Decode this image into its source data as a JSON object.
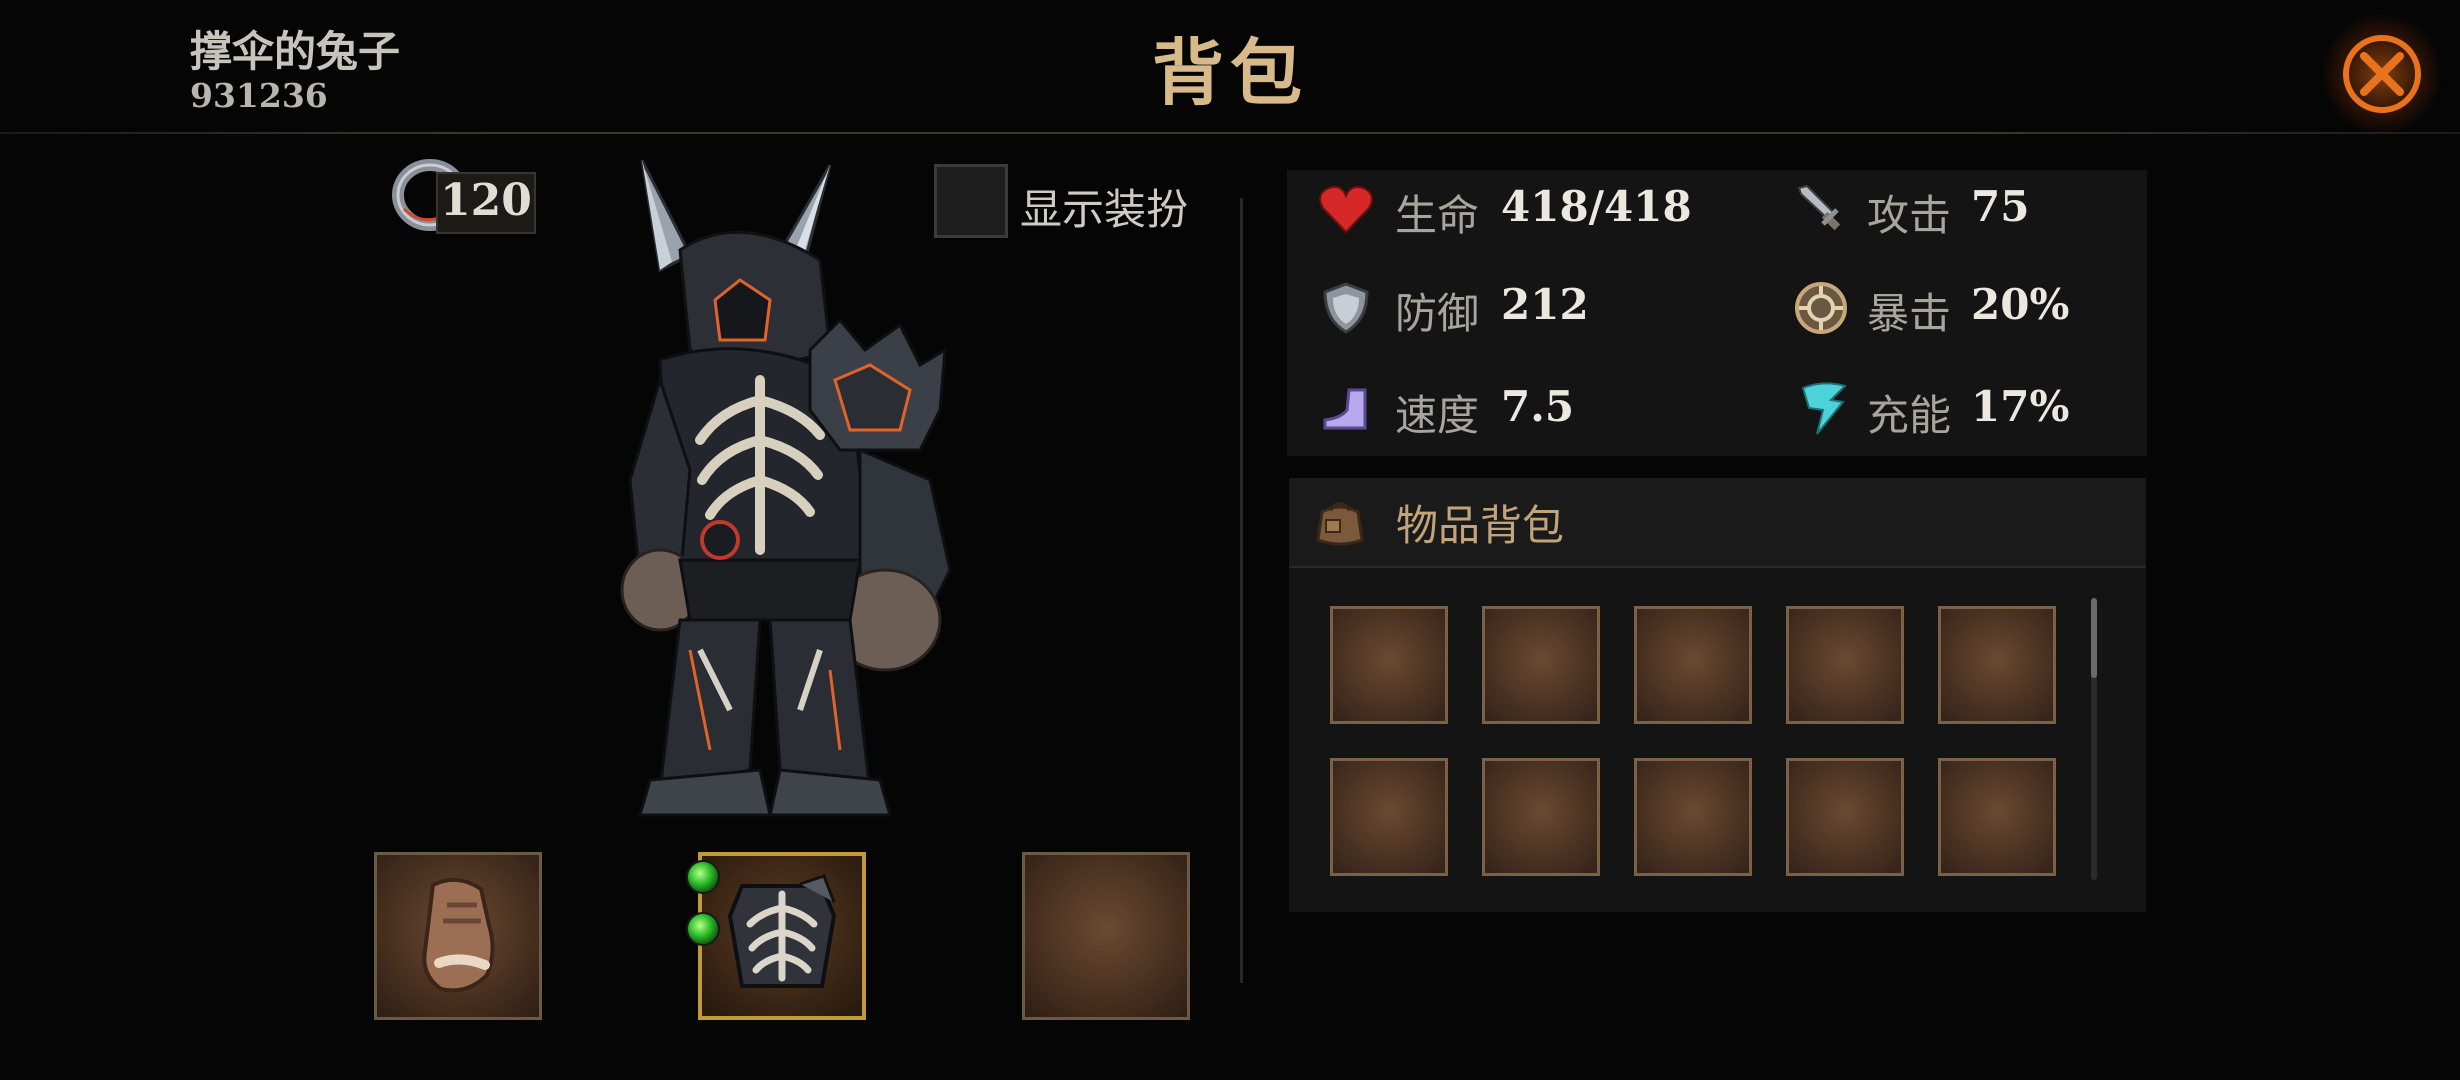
{
  "header": {
    "player_name": "撑伞的兔子",
    "player_id": "931236",
    "title": "背包"
  },
  "left_panel": {
    "ring_count": "120",
    "show_outfit_label": "显示装扮",
    "show_outfit_checked": false,
    "equipment_slots": [
      {
        "name": "gloves",
        "filled": true
      },
      {
        "name": "armor",
        "filled": true,
        "gems": 2
      },
      {
        "name": "empty",
        "filled": false
      }
    ]
  },
  "stats": {
    "hp_label": "生命",
    "hp_value": "418/418",
    "attack_label": "攻击",
    "attack_value": "75",
    "defense_label": "防御",
    "defense_value": "212",
    "crit_label": "暴击",
    "crit_value": "20%",
    "speed_label": "速度",
    "speed_value": "7.5",
    "charge_label": "充能",
    "charge_value": "17%"
  },
  "inventory": {
    "title": "物品背包",
    "visible_slots": 10
  },
  "colors": {
    "accent_gold": "#d8b98a",
    "hp_red": "#d62828",
    "charge_cyan": "#4fd1d9",
    "close_glow": "#e06a14"
  }
}
